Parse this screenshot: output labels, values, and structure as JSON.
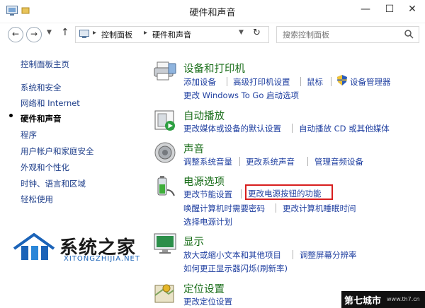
{
  "window": {
    "title": "硬件和声音",
    "minimize": "—",
    "maximize": "☐",
    "close": "✕"
  },
  "address": {
    "breadcrumb": [
      "控制面板",
      "硬件和声音"
    ],
    "search_placeholder": "搜索控制面板"
  },
  "sidebar": {
    "items": [
      {
        "label": "控制面板主页",
        "active": false
      },
      {
        "label": "系统和安全",
        "active": false
      },
      {
        "label": "网络和 Internet",
        "active": false
      },
      {
        "label": "硬件和声音",
        "active": true
      },
      {
        "label": "程序",
        "active": false
      },
      {
        "label": "用户帐户和家庭安全",
        "active": false
      },
      {
        "label": "外观和个性化",
        "active": false
      },
      {
        "label": "时钟、语言和区域",
        "active": false
      },
      {
        "label": "轻松使用",
        "active": false
      }
    ]
  },
  "categories": [
    {
      "title": "设备和打印机",
      "links": [
        "添加设备",
        "高级打印机设置",
        "鼠标",
        "设备管理器",
        "更改 Windows To Go 启动选项"
      ]
    },
    {
      "title": "自动播放",
      "links": [
        "更改媒体或设备的默认设置",
        "自动播放 CD 或其他媒体"
      ]
    },
    {
      "title": "声音",
      "links": [
        "调整系统音量",
        "更改系统声音",
        "管理音频设备"
      ]
    },
    {
      "title": "电源选项",
      "links": [
        "更改节能设置",
        "更改电源按钮的功能",
        "唤醒计算机时需要密码",
        "更改计算机睡眠时间",
        "选择电源计划"
      ]
    },
    {
      "title": "显示",
      "links": [
        "放大或缩小文本和其他项目",
        "调整屏幕分辨率",
        "如何更正显示器闪烁(刷新率)"
      ]
    },
    {
      "title": "定位设置",
      "links": [
        "更改定位设置"
      ]
    }
  ],
  "watermark": {
    "name": "系统之家",
    "domain": "XITONGZHIJIA.NET",
    "corner_text": "第七城市",
    "corner_domain": "www.th7.cn"
  },
  "colors": {
    "category_title": "#1a6e1a",
    "link": "#1f3fa0",
    "highlight": "#d81e1e"
  }
}
